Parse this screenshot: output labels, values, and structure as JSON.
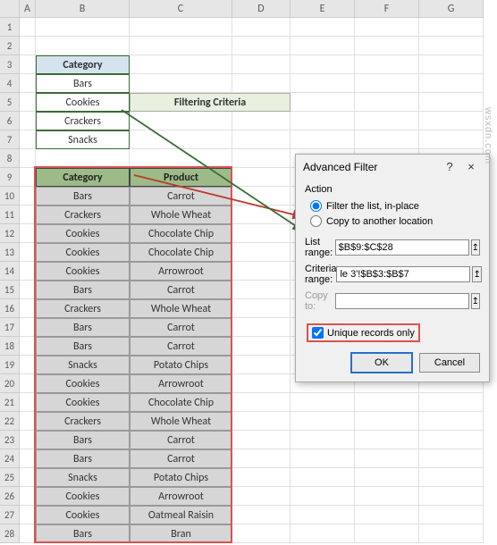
{
  "columns": [
    "A",
    "B",
    "C",
    "D",
    "E",
    "F",
    "G"
  ],
  "rows": [
    "1",
    "2",
    "3",
    "4",
    "5",
    "6",
    "7",
    "8",
    "9",
    "10",
    "11",
    "12",
    "13",
    "14",
    "15",
    "16",
    "17",
    "18",
    "19",
    "20",
    "21",
    "22",
    "23",
    "24",
    "25",
    "26",
    "27",
    "28"
  ],
  "category_table": {
    "header": "Category",
    "items": [
      "Bars",
      "Cookies",
      "Crackers",
      "Snacks"
    ]
  },
  "filtering_label": "Filtering Criteria",
  "data_table": {
    "headers": [
      "Category",
      "Product"
    ],
    "rows": [
      [
        "Bars",
        "Carrot"
      ],
      [
        "Crackers",
        "Whole Wheat"
      ],
      [
        "Cookies",
        "Chocolate Chip"
      ],
      [
        "Cookies",
        "Chocolate Chip"
      ],
      [
        "Cookies",
        "Arrowroot"
      ],
      [
        "Bars",
        "Carrot"
      ],
      [
        "Crackers",
        "Whole Wheat"
      ],
      [
        "Bars",
        "Carrot"
      ],
      [
        "Bars",
        "Carrot"
      ],
      [
        "Snacks",
        "Potato Chips"
      ],
      [
        "Cookies",
        "Arrowroot"
      ],
      [
        "Cookies",
        "Chocolate Chip"
      ],
      [
        "Crackers",
        "Whole Wheat"
      ],
      [
        "Bars",
        "Carrot"
      ],
      [
        "Bars",
        "Carrot"
      ],
      [
        "Snacks",
        "Potato Chips"
      ],
      [
        "Cookies",
        "Arrowroot"
      ],
      [
        "Cookies",
        "Oatmeal Raisin"
      ],
      [
        "Bars",
        "Bran"
      ]
    ]
  },
  "dialog": {
    "title": "Advanced Filter",
    "help": "?",
    "close": "×",
    "action_label": "Action",
    "radio1": "Filter the list, in-place",
    "radio2": "Copy to another location",
    "list_range_label": "List range:",
    "list_range_value": "$B$9:$C$28",
    "criteria_range_label": "Criteria range:",
    "criteria_range_value": "le 3'!$B$3:$B$7",
    "copy_to_label": "Copy to:",
    "copy_to_value": "",
    "unique_label": "Unique records only",
    "ok": "OK",
    "cancel": "Cancel"
  },
  "watermark": "wsxdn.com"
}
